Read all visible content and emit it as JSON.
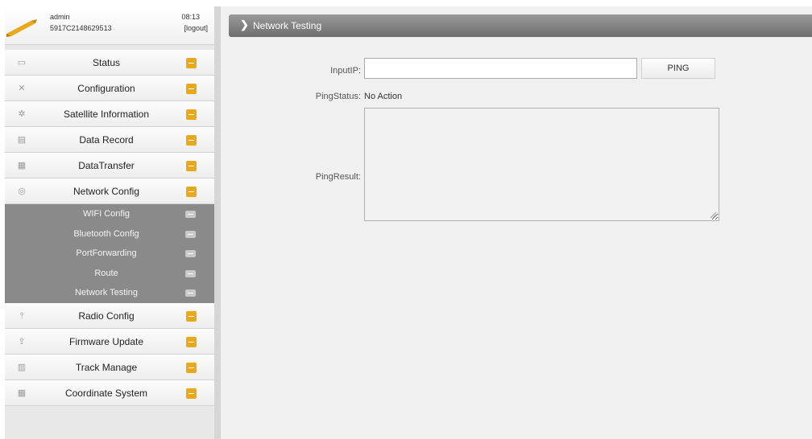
{
  "user": {
    "name": "admin",
    "serial": "5917C2148629513",
    "time": "08:13",
    "logout_label": "[logout]"
  },
  "menu": {
    "items_top": [
      {
        "label": "Status",
        "icon": "monitor-icon"
      },
      {
        "label": "Configuration",
        "icon": "tools-icon"
      },
      {
        "label": "Satellite Information",
        "icon": "satellite-icon"
      },
      {
        "label": "Data Record",
        "icon": "record-icon"
      },
      {
        "label": "DataTransfer",
        "icon": "transfer-icon"
      },
      {
        "label": "Network Config",
        "icon": "network-icon"
      }
    ],
    "submenu": [
      {
        "label": "WIFI Config"
      },
      {
        "label": "Bluetooth Config"
      },
      {
        "label": "PortForwarding"
      },
      {
        "label": "Route"
      },
      {
        "label": "Network Testing"
      }
    ],
    "items_bottom": [
      {
        "label": "Radio Config",
        "icon": "antenna-icon"
      },
      {
        "label": "Firmware Update",
        "icon": "upload-icon"
      },
      {
        "label": "Track Manage",
        "icon": "track-icon"
      },
      {
        "label": "Coordinate System",
        "icon": "coordinate-icon"
      }
    ]
  },
  "page": {
    "title": "Network Testing"
  },
  "form": {
    "input_ip_label": "InputIP:",
    "input_ip_value": "",
    "ping_button_label": "PING",
    "ping_status_label": "PingStatus:",
    "ping_status_value": "No Action",
    "ping_result_label": "PingResult:",
    "ping_result_value": ""
  },
  "colors": {
    "accent_orange": "#e8a91c",
    "submenu_bg": "#8a8a8a",
    "title_bar": "#7e7e7e",
    "content_bg": "#f0f0f0"
  }
}
